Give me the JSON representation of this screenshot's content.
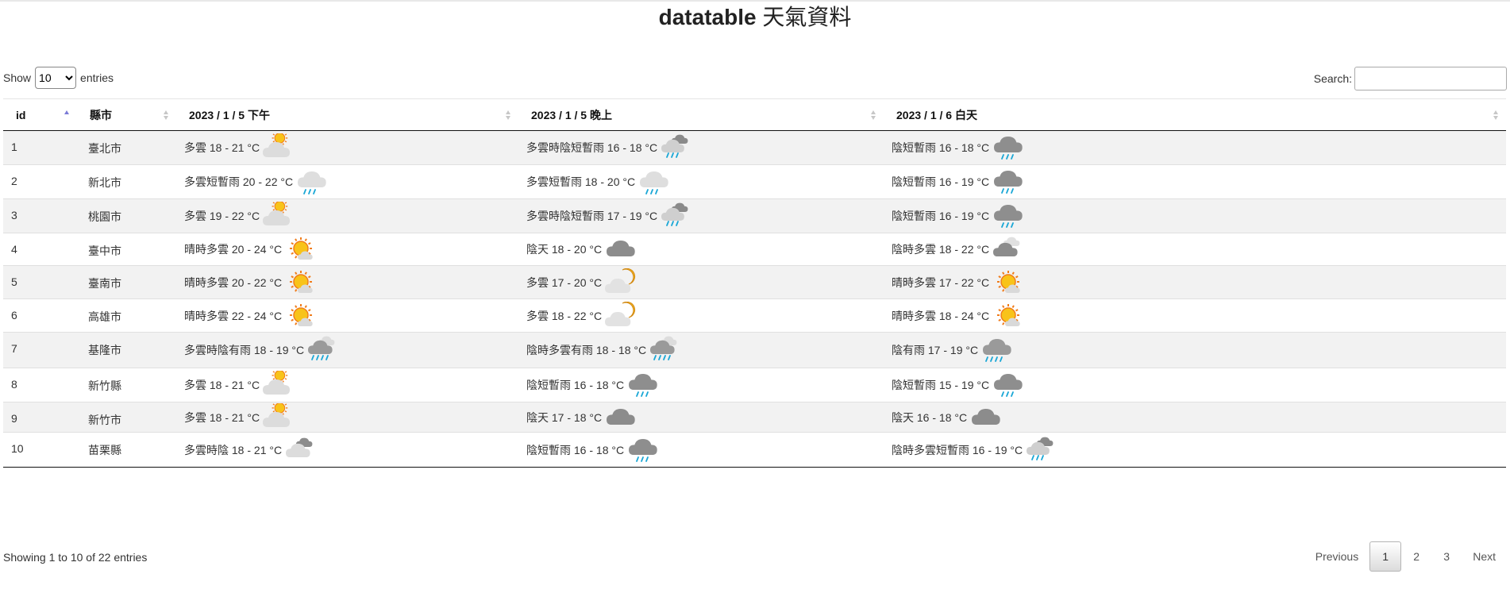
{
  "title_en": "datatable",
  "title_zh": "天氣資料",
  "length": {
    "show": "Show",
    "value": "10",
    "entries": "entries"
  },
  "search": {
    "label": "Search:",
    "value": ""
  },
  "columns": [
    "id",
    "縣市",
    "2023 / 1 / 5 下午",
    "2023 / 1 / 5 晚上",
    "2023 / 1 / 6 白天"
  ],
  "rows": [
    {
      "id": "1",
      "city": "臺北市",
      "c1": {
        "t": "多雲 18 - 21 °C",
        "icon": "partly-cloudy-sun-icon"
      },
      "c2": {
        "t": "多雲時陰短暫雨 16 - 18 °C",
        "icon": "cloudy-shower-icon"
      },
      "c3": {
        "t": "陰短暫雨 16 - 18 °C",
        "icon": "dark-rain-cloud-icon"
      }
    },
    {
      "id": "2",
      "city": "新北市",
      "c1": {
        "t": "多雲短暫雨 20 - 22 °C",
        "icon": "light-rain-cloud-icon"
      },
      "c2": {
        "t": "多雲短暫雨 18 - 20 °C",
        "icon": "light-rain-cloud-icon"
      },
      "c3": {
        "t": "陰短暫雨 16 - 19 °C",
        "icon": "dark-rain-cloud-icon"
      }
    },
    {
      "id": "3",
      "city": "桃園市",
      "c1": {
        "t": "多雲 19 - 22 °C",
        "icon": "partly-cloudy-sun-icon"
      },
      "c2": {
        "t": "多雲時陰短暫雨 17 - 19 °C",
        "icon": "cloudy-shower-icon"
      },
      "c3": {
        "t": "陰短暫雨 16 - 19 °C",
        "icon": "dark-rain-cloud-icon"
      }
    },
    {
      "id": "4",
      "city": "臺中市",
      "c1": {
        "t": "晴時多雲 20 - 24 °C",
        "icon": "sun-cloud-icon"
      },
      "c2": {
        "t": "陰天 18 - 20 °C",
        "icon": "overcast-cloud-icon"
      },
      "c3": {
        "t": "陰時多雲 18 - 22 °C",
        "icon": "mostly-cloudy-icon"
      }
    },
    {
      "id": "5",
      "city": "臺南市",
      "c1": {
        "t": "晴時多雲 20 - 22 °C",
        "icon": "sun-cloud-icon"
      },
      "c2": {
        "t": "多雲 17 - 20 °C",
        "icon": "cloudy-moon-icon"
      },
      "c3": {
        "t": "晴時多雲 17 - 22 °C",
        "icon": "sun-cloud-icon"
      }
    },
    {
      "id": "6",
      "city": "高雄市",
      "c1": {
        "t": "晴時多雲 22 - 24 °C",
        "icon": "sun-cloud-icon"
      },
      "c2": {
        "t": "多雲 18 - 22 °C",
        "icon": "cloudy-moon-icon"
      },
      "c3": {
        "t": "晴時多雲 18 - 24 °C",
        "icon": "sun-cloud-icon"
      }
    },
    {
      "id": "7",
      "city": "基隆市",
      "c1": {
        "t": "多雲時陰有雨 18 - 19 °C",
        "icon": "cloudy-heavy-rain-icon"
      },
      "c2": {
        "t": "陰時多雲有雨 18 - 18 °C",
        "icon": "cloudy-heavy-rain-icon"
      },
      "c3": {
        "t": "陰有雨 17 - 19 °C",
        "icon": "heavy-rain-cloud-icon"
      }
    },
    {
      "id": "8",
      "city": "新竹縣",
      "c1": {
        "t": "多雲 18 - 21 °C",
        "icon": "partly-cloudy-sun-icon"
      },
      "c2": {
        "t": "陰短暫雨 16 - 18 °C",
        "icon": "dark-rain-cloud-icon"
      },
      "c3": {
        "t": "陰短暫雨 15 - 19 °C",
        "icon": "dark-rain-cloud-icon"
      }
    },
    {
      "id": "9",
      "city": "新竹市",
      "c1": {
        "t": "多雲 18 - 21 °C",
        "icon": "partly-cloudy-sun-icon"
      },
      "c2": {
        "t": "陰天 17 - 18 °C",
        "icon": "overcast-cloud-icon"
      },
      "c3": {
        "t": "陰天 16 - 18 °C",
        "icon": "overcast-cloud-icon"
      }
    },
    {
      "id": "10",
      "city": "苗栗縣",
      "c1": {
        "t": "多雲時陰 18 - 21 °C",
        "icon": "cloudy-overcast-icon"
      },
      "c2": {
        "t": "陰短暫雨 16 - 18 °C",
        "icon": "dark-rain-cloud-icon"
      },
      "c3": {
        "t": "陰時多雲短暫雨 16 - 19 °C",
        "icon": "cloudy-shower-icon"
      }
    }
  ],
  "info": "Showing 1 to 10 of 22 entries",
  "pager": {
    "previous": "Previous",
    "pages": [
      "1",
      "2",
      "3"
    ],
    "next": "Next",
    "current": "1"
  }
}
